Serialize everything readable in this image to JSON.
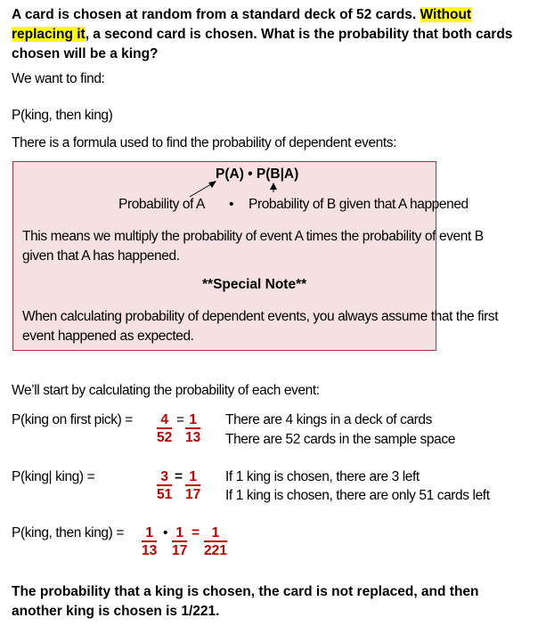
{
  "problem": {
    "part1": "A card is chosen at random from a standard deck of 52 cards.  ",
    "highlight": "Without replacing it",
    "part2": ", a second card is chosen.  What is the probability that both cards chosen will be a king?"
  },
  "want_label": "We want to find:",
  "target_expression": "P(king, then king)",
  "formula_intro": "There is a formula used to find the probability of dependent events:",
  "note_box": {
    "formula": "P(A) • P(B|A)",
    "label_a": "Probability of A",
    "bullet": "•",
    "label_b": "Probability of B given that A happened",
    "explanation": "This means we multiply the probability of event A times the probability of event B given that A has happened.",
    "special_title": "**Special Note**",
    "special_text": "When calculating probability of dependent events, you always assume that the first event happened as expected."
  },
  "calc_intro": "We’ll start by calculating the probability of each event:",
  "step1": {
    "label": "P(king on first pick) =",
    "frac1": {
      "num": "4",
      "den": "52"
    },
    "eq": "=",
    "frac2": {
      "num": "1",
      "den": "13"
    },
    "note1": "There are 4 kings in a deck of cards",
    "note2": "There are 52 cards in the sample space"
  },
  "step2": {
    "label": "P(king| king)  =",
    "frac1": {
      "num": "3",
      "den": "51"
    },
    "eq": "=",
    "frac2": {
      "num": "1",
      "den": "17"
    },
    "note1": "If 1 king is chosen, there are 3 left",
    "note2": "If 1 king is chosen, there are only 51 cards left"
  },
  "step3": {
    "label": "P(king, then king)  =",
    "frac1": {
      "num": "1",
      "den": "13"
    },
    "dot": "•",
    "frac2": {
      "num": "1",
      "den": "17"
    },
    "eq": "=",
    "frac3": {
      "num": "1",
      "den": "221"
    }
  },
  "conclusion": "The probability that a king is chosen, the card is not replaced, and then another king is chosen is 1/221."
}
